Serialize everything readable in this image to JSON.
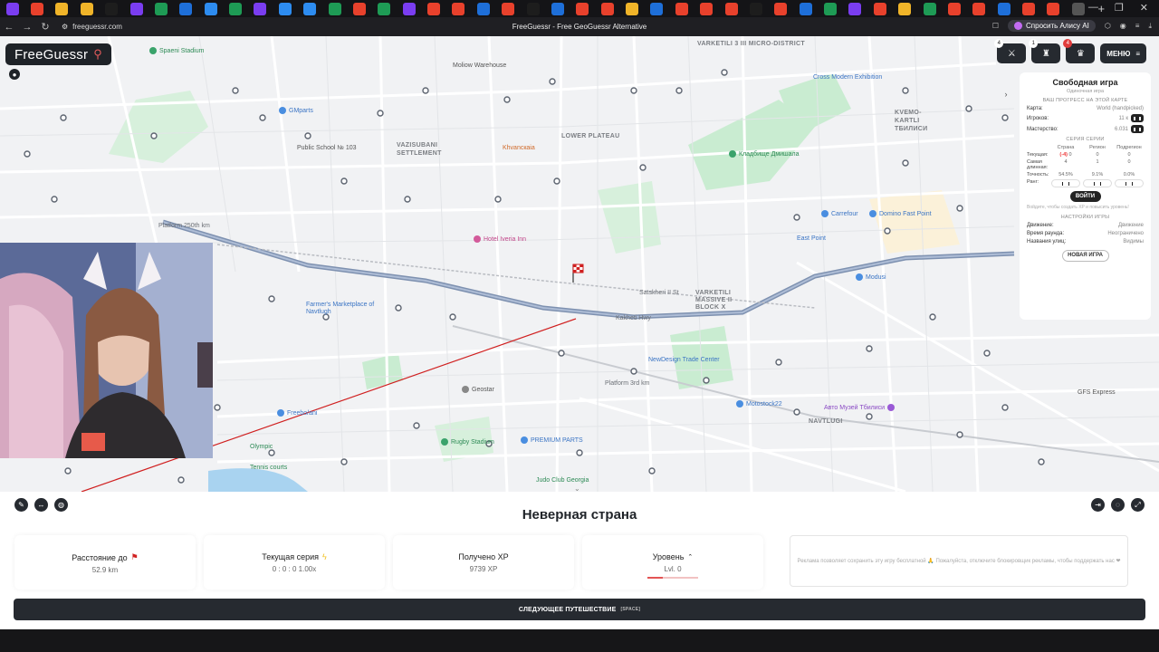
{
  "browser": {
    "url": "freeguessr.com",
    "page_title": "FreeGuessr - Free GeoGuessr Alternative",
    "alice_button": "Спросить Алису AI"
  },
  "app": {
    "logo": "FreeGuessr",
    "menu_label": "МЕНЮ",
    "badges": {
      "versus": "4",
      "party": "1",
      "trophy": "4"
    }
  },
  "map": {
    "districts": [
      "VARKETILI 3 III MICRO-DISTRICT",
      "VAZISUBANI SETTLEMENT",
      "LOWER PLATEAU",
      "KVEMO-KARTLI ТБИЛИСИ",
      "VARKETILI MASSIVE II BLOCK X",
      "NAVTLUGI"
    ],
    "places": [
      "Spaeni Stadium",
      "Moliow Warehouse",
      "GMparts",
      "Public School № 103",
      "Khvancкaia",
      "Hotel Iveria Inn",
      "Farmer's Marketplace of Navtlugh",
      "NewDesign Trade Center",
      "Geostar",
      "Rugby Stadium",
      "PREMIUM PARTS",
      "Motostock22",
      "Авто Музей Тбилиси",
      "Carrefour",
      "Domino Fast Point",
      "East Point",
      "Cross Modern Exhibition",
      "Кладбище Дмишала",
      "Modusi",
      "Freebo/ani",
      "Olympic",
      "Tennis courts",
      "Judo Club Georgia",
      "GFS Express",
      "Platform 250th km",
      "Platform 3rd km",
      "Satskheri II St",
      "Kakheti Hwy"
    ]
  },
  "panel": {
    "title": "Свободная игра",
    "subtitle": "Одиночная игра",
    "progress_header": "ВАШ ПРОГРЕСС НА ЭТОЙ КАРТЕ",
    "rows": [
      {
        "label": "Карта:",
        "value": "World (handpicked)"
      },
      {
        "label": "Игроков:",
        "value": "11 к"
      },
      {
        "label": "Мастерство:",
        "value": "6.031"
      }
    ],
    "series_header": "СЕРИЯ СЕРИИ",
    "columns": [
      "Страна",
      "Регион",
      "Подрегион"
    ],
    "stats": [
      {
        "label": "Текущая:",
        "values": [
          "(-4)",
          "0",
          "0",
          "0"
        ]
      },
      {
        "label": "Самая длинная:",
        "values": [
          "4",
          "1",
          "0"
        ]
      },
      {
        "label": "Точность:",
        "values": [
          "54.5%",
          "9.1%",
          "0.0%"
        ]
      }
    ],
    "rank_label": "Ранг:",
    "login": "ВОЙТИ",
    "hint": "Войдите, чтобы создать XP и повысить уровень!",
    "settings_header": "НАСТРОЙКИ ИГРЫ",
    "settings": [
      {
        "label": "Движение:",
        "value": "Движение"
      },
      {
        "label": "Время раунда:",
        "value": "Неограничено"
      },
      {
        "label": "Названия улиц:",
        "value": "Видимы"
      }
    ],
    "new_game": "НОВАЯ ИГРА"
  },
  "result": {
    "title": "Неверная страна",
    "cards": [
      {
        "label": "Расстояние до",
        "value": "52.9 km"
      },
      {
        "label": "Текущая серия",
        "value": "0 : 0 : 0  1.00x"
      },
      {
        "label": "Получено XP",
        "value": "9739 XP"
      },
      {
        "label": "Уровень",
        "value": "Lvl. 0"
      }
    ],
    "level_progress": 0.3,
    "ad_text": "Реклама позволяет сохранить эту игру бесплатной 🙏 Пожалуйста, отключите блокировщик рекламы, чтобы поддержать нас ❤",
    "next_button": "СЛЕДУЮЩЕЕ ПУТЕШЕСТВИЕ",
    "next_key": "[SPACE]"
  },
  "colors": {
    "accent_dark": "#262a30",
    "guess_line": "#d02020",
    "road_major": "#8aa0c0",
    "park": "#c9ecd1"
  }
}
